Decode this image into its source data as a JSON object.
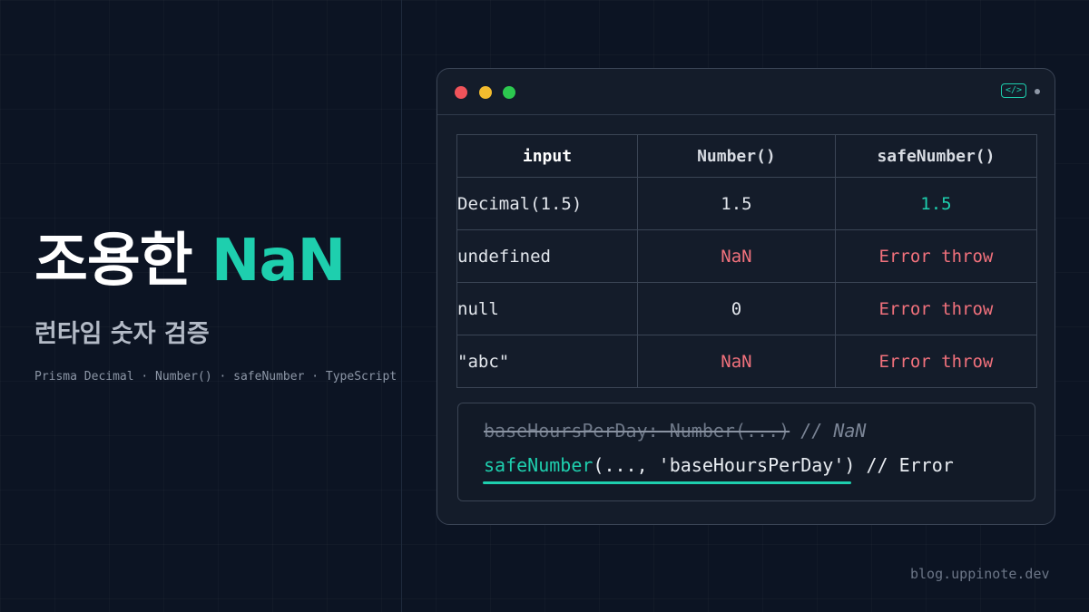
{
  "hero": {
    "title_main": "조용한 ",
    "title_accent": "NaN",
    "subtitle": "런타임 숫자 검증",
    "tags": "Prisma Decimal · Number() · safeNumber · TypeScript"
  },
  "window": {
    "code_icon": "</>"
  },
  "table": {
    "headers": [
      "input",
      "Number()",
      "safeNumber()"
    ],
    "rows": [
      [
        "Decimal(1.5)",
        "1.5",
        "1.5"
      ],
      [
        "undefined",
        "NaN",
        "Error throw"
      ],
      [
        "null",
        "0",
        "Error throw"
      ],
      [
        "\"abc\"",
        "NaN",
        "Error throw"
      ]
    ]
  },
  "code": {
    "line1_struck": "baseHoursPerDay: Number(...)",
    "line1_comment": " // NaN",
    "line2_fn": "safeNumber",
    "line2_args": "(..., 'baseHoursPerDay')",
    "line2_comment": " // Error"
  },
  "footer": "blog.uppinote.dev",
  "colors": {
    "background": "#0c1423",
    "accent": "#1ecfae",
    "error": "#f1717c",
    "window_bg": "#141c2a"
  },
  "icons": [
    "code-icon",
    "status-dot-icon",
    "close-dot-icon",
    "minimize-dot-icon",
    "maximize-dot-icon"
  ]
}
